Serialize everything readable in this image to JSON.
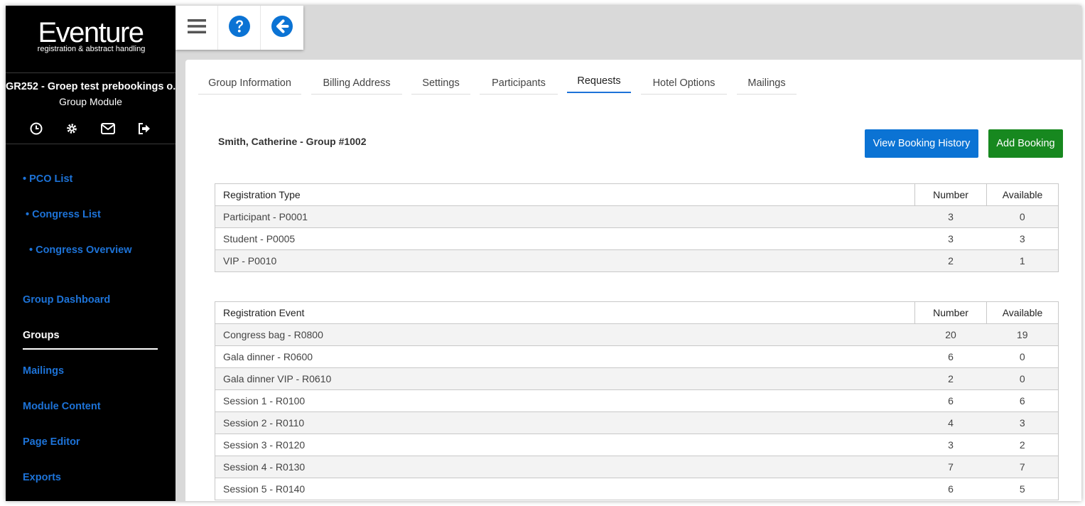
{
  "logo": {
    "name": "Eventure",
    "tagline": "registration & abstract handling"
  },
  "sidebar": {
    "group_title": "GR252 - Groep test prebookings o...",
    "module": "Group Module",
    "icons": [
      "clock-icon",
      "gear-icon",
      "envelope-icon",
      "sign-out-icon"
    ],
    "sub_items": [
      {
        "label": "• PCO List"
      },
      {
        "label": "• Congress List"
      },
      {
        "label": "• Congress Overview"
      }
    ],
    "items": [
      {
        "label": "Group Dashboard",
        "active": false
      },
      {
        "label": "Groups",
        "active": true
      },
      {
        "label": "Mailings",
        "active": false
      },
      {
        "label": "Module Content",
        "active": false
      },
      {
        "label": "Page Editor",
        "active": false
      },
      {
        "label": "Exports",
        "active": false
      }
    ]
  },
  "toolbar": {
    "icons": [
      "menu-icon",
      "help-icon",
      "back-arrow-icon"
    ]
  },
  "tabs": [
    {
      "label": "Group Information",
      "active": false
    },
    {
      "label": "Billing Address",
      "active": false
    },
    {
      "label": "Settings",
      "active": false
    },
    {
      "label": "Participants",
      "active": false
    },
    {
      "label": "Requests",
      "active": true
    },
    {
      "label": "Hotel Options",
      "active": false
    },
    {
      "label": "Mailings",
      "active": false
    }
  ],
  "client": {
    "name": "Smith, Catherine - Group #1002"
  },
  "buttons": {
    "history": "View Booking History",
    "add": "Add Booking"
  },
  "registration_types": {
    "headers": [
      "Registration Type",
      "Number",
      "Available"
    ],
    "rows": [
      [
        "Participant - P0001",
        "3",
        "0"
      ],
      [
        "Student - P0005",
        "3",
        "3"
      ],
      [
        "VIP - P0010",
        "2",
        "1"
      ]
    ]
  },
  "registration_events": {
    "headers": [
      "Registration Event",
      "Number",
      "Available"
    ],
    "rows": [
      [
        "Congress bag - R0800",
        "20",
        "19"
      ],
      [
        "Gala dinner - R0600",
        "6",
        "0"
      ],
      [
        "Gala dinner VIP - R0610",
        "2",
        "0"
      ],
      [
        "Session 1 - R0100",
        "6",
        "6"
      ],
      [
        "Session 2 - R0110",
        "4",
        "3"
      ],
      [
        "Session 3 - R0120",
        "3",
        "2"
      ],
      [
        "Session 4 - R0130",
        "7",
        "7"
      ],
      [
        "Session 5 - R0140",
        "6",
        "5"
      ]
    ]
  },
  "colors": {
    "link": "#1d73d8",
    "primary": "#0b73d4",
    "success": "#17881f"
  }
}
